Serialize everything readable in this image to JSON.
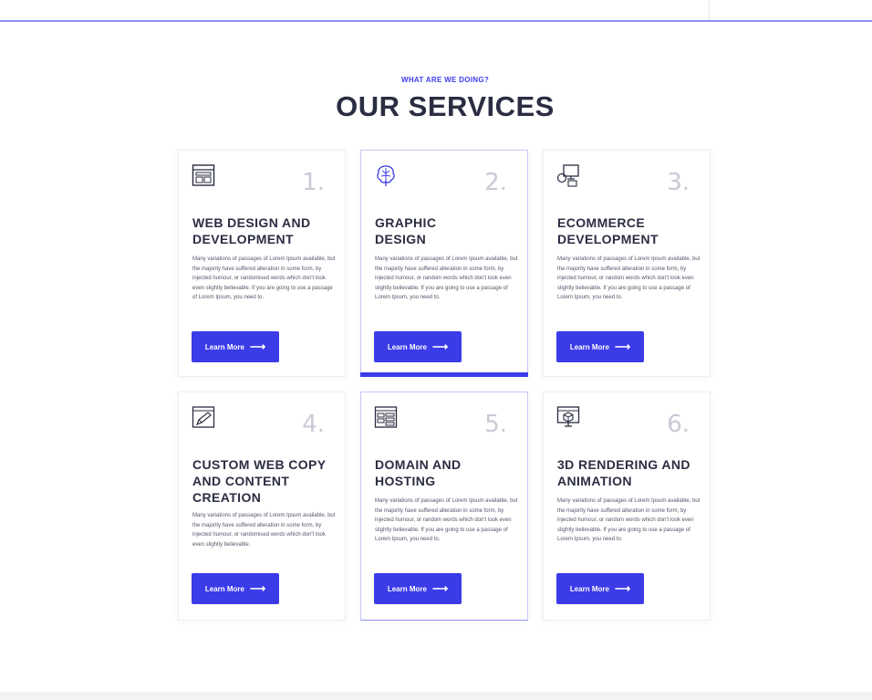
{
  "section": {
    "eyebrow": "WHAT ARE WE DOING?",
    "title": "OUR SERVICES"
  },
  "colors": {
    "accent": "#3b3be8",
    "heading": "#2b2d42",
    "number": "#c9c9d4"
  },
  "services": [
    {
      "number": "1.",
      "title": "WEB DESIGN AND DEVELOPMENT",
      "description": "Many variations of passages of Lorem Ipsum available, but the majority have suffered alteration in some form, by injected humour, or randomised words which don't look even slightly believable. If you are going to use a passage of Lorem Ipsum, you need to.",
      "button": "Learn More",
      "icon": "browser-window-icon"
    },
    {
      "number": "2.",
      "title": "GRAPHIC DESIGN",
      "description": "Many variations of passages of Lorem Ipsum available, but the majority have suffered alteration in some form, by injected humour, or random words which don't look even slightly believable. If you are going to use a passage of Lorem Ipsum, you need to.",
      "button": "Learn More",
      "icon": "brain-icon"
    },
    {
      "number": "3.",
      "title": "ECOMMERCE DEVELOPMENT",
      "description": "Many variations of passages of Lorem Ipsum available, but the majority have suffered alteration in some form, by injected humour, or random words which don't look even slightly believable. If you are going to use a passage of Lorem Ipsum, you need to.",
      "button": "Learn More",
      "icon": "devices-icon"
    },
    {
      "number": "4.",
      "title": "CUSTOM WEB COPY AND CONTENT CREATION",
      "description": "Many variations of passages of Lorem Ipsum available, but the majority have suffered alteration in some form, by injected humour, or randomised words which don't look even slightly believable.",
      "button": "Learn More",
      "icon": "pencil-edit-icon"
    },
    {
      "number": "5.",
      "title": "DOMAIN AND HOSTING",
      "description": "Many variations of passages of Lorem Ipsum available, but the majority have suffered alteration in some form, by injected humour, or random words which don't look even slightly believable. If you are going to use a passage of Lorem Ipsum, you need to.",
      "button": "Learn More",
      "icon": "server-icon"
    },
    {
      "number": "6.",
      "title": "3D RENDERING AND ANIMATION",
      "description": "Many variations of passages of Lorem Ipsum available, but the majority have suffered alteration in some form, by injected humour, or random words which don't look even slightly believable. If you are going to use a passage of Lorem Ipsum, you need to.",
      "button": "Learn More",
      "icon": "monitor-cube-icon"
    }
  ]
}
